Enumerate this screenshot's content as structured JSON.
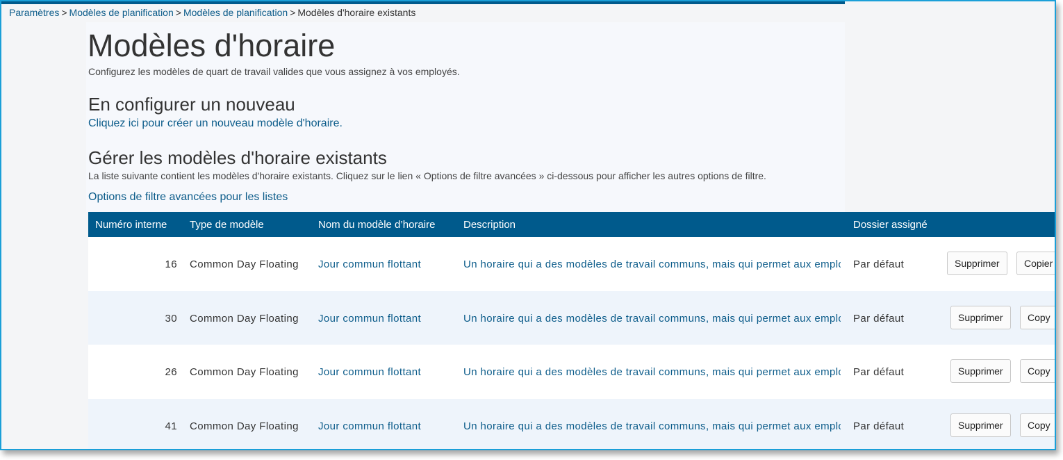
{
  "breadcrumb": {
    "items": [
      "Paramètres",
      "Modèles de planification",
      "Modèles de planification",
      "Modèles d'horaire existants"
    ],
    "separator": ">"
  },
  "header": {
    "title": "Modèles d'horaire",
    "subtitle": "Configurez les modèles de quart de travail valides que vous assignez à vos employés."
  },
  "new_section": {
    "heading": "En configurer un nouveau",
    "link": "Cliquez ici pour créer un nouveau modèle d'horaire."
  },
  "manage_section": {
    "heading": "Gérer les modèles d'horaire existants",
    "description": "La liste suivante contient les modèles d'horaire existants. Cliquez sur le lien « Options de filtre avancées » ci-dessous pour afficher les autres options de filtre.",
    "filter_link": "Options de filtre avancées pour les listes"
  },
  "table": {
    "columns": [
      "Numéro interne",
      "Type de modèle",
      "Nom du modèle d’horaire",
      "Description",
      "Dossier assigné"
    ],
    "rows": [
      {
        "id": "16",
        "type": "Common Day Floating",
        "name": "Jour commun flottant",
        "description": "Un horaire qui a des modèles de travail communs, mais qui permet aux employés de travailler",
        "folder": "Par défaut",
        "delete_label": "Supprimer",
        "copy_label": "Copier"
      },
      {
        "id": "30",
        "type": "Common Day Floating",
        "name": "Jour commun flottant",
        "description": "Un horaire qui a des modèles de travail communs, mais qui permet aux employés de travailler",
        "folder": "Par défaut",
        "delete_label": "Supprimer",
        "copy_label": "Copy"
      },
      {
        "id": "26",
        "type": "Common Day Floating",
        "name": "Jour commun flottant",
        "description": "Un horaire qui a des modèles de travail communs, mais qui permet aux employés de travailler",
        "folder": "Par défaut",
        "delete_label": "Supprimer",
        "copy_label": "Copy"
      },
      {
        "id": "41",
        "type": "Common Day Floating",
        "name": "Jour commun flottant",
        "description": "Un horaire qui a des modèles de travail communs, mais qui permet aux employés de travailler",
        "folder": "Par défaut",
        "delete_label": "Supprimer",
        "copy_label": "Copy"
      }
    ]
  },
  "colors": {
    "accent": "#005a8c",
    "link": "#0c5c8a",
    "frame_border": "#1a9fd8",
    "row_alt": "#eef4fb"
  }
}
